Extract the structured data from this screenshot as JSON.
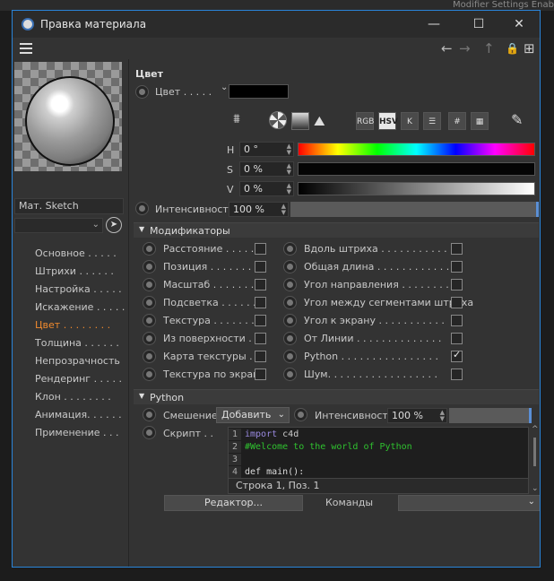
{
  "background": {
    "behind_text": "Modifier Settings Enable"
  },
  "window": {
    "title": "Правка материала",
    "minimize": "—",
    "maximize": "☐",
    "close": "✕"
  },
  "toolbar": {
    "back": "←",
    "forward": "→",
    "up": "↑",
    "lock": "🔒",
    "new": "⊞"
  },
  "left": {
    "material_name": "Мат. Sketch",
    "nav": [
      {
        "label": "Основное . . . . ."
      },
      {
        "label": "Штрихи . . . . . ."
      },
      {
        "label": "Настройка . . . . ."
      },
      {
        "label": "Искажение . . . . ."
      },
      {
        "label": "Цвет . . . . . . . ."
      },
      {
        "label": "Толщина . . . . . ."
      },
      {
        "label": "Непрозрачность"
      },
      {
        "label": "Рендеринг . . . . ."
      },
      {
        "label": "Клон . . . . . . . ."
      },
      {
        "label": "Анимация. . . . . ."
      },
      {
        "label": "Применение . . ."
      }
    ]
  },
  "color": {
    "section_title": "Цвет",
    "label": "Цвет . . . . .",
    "swatch_color": "#000000",
    "modes": [
      "RGB",
      "HSV",
      "K",
      "☰",
      "#",
      "▦"
    ],
    "h_label": "H",
    "h_value": "0 °",
    "s_label": "S",
    "s_value": "0 %",
    "v_label": "V",
    "v_value": "0 %",
    "intensity_label": "Интенсивность",
    "intensity_value": "100 %"
  },
  "modifiers": {
    "title": "Модификаторы",
    "left": [
      {
        "label": "Расстояние . . . . . .",
        "checked": false
      },
      {
        "label": "Позиция . . . . . . . .",
        "checked": false
      },
      {
        "label": "Масштаб . . . . . . . .",
        "checked": false
      },
      {
        "label": "Подсветка . . . . . .",
        "checked": false
      },
      {
        "label": "Текстура . . . . . . . .",
        "checked": false
      },
      {
        "label": "Из поверхности . .",
        "checked": false
      },
      {
        "label": "Карта текстуры . .",
        "checked": false
      },
      {
        "label": "Текстура по экрану",
        "checked": false
      }
    ],
    "right": [
      {
        "label": "Вдоль штриха . . . . . . . . . . . .",
        "checked": false
      },
      {
        "label": "Общая длина . . . . . . . . . . . .",
        "checked": false
      },
      {
        "label": "Угол направления . . . . . . . . .",
        "checked": false
      },
      {
        "label": "Угол между сегментами штриха",
        "checked": false
      },
      {
        "label": "Угол к экрану . . . . . . . . . . .",
        "checked": false
      },
      {
        "label": "От Линии . . . . . . . . . . . . . .",
        "checked": false
      },
      {
        "label": "Python . . . . . . . . . . . . . . . .",
        "checked": true
      },
      {
        "label": "Шум. . . . . . . . . . . . . . . . . .",
        "checked": false
      }
    ]
  },
  "python": {
    "title": "Python",
    "blend_label": "Смешение",
    "blend_value": "Добавить",
    "intensity_label": "Интенсивность",
    "intensity_value": "100 %",
    "script_label": "Скрипт . .",
    "code_lines": [
      {
        "n": "1",
        "text": "import c4d"
      },
      {
        "n": "2",
        "text": "#Welcome to the world of Python"
      },
      {
        "n": "3",
        "text": ""
      },
      {
        "n": "4",
        "text": "def main():"
      }
    ],
    "status": "Строка 1, Поз. 1",
    "editor_button": "Редактор...",
    "commands_label": "Команды"
  }
}
